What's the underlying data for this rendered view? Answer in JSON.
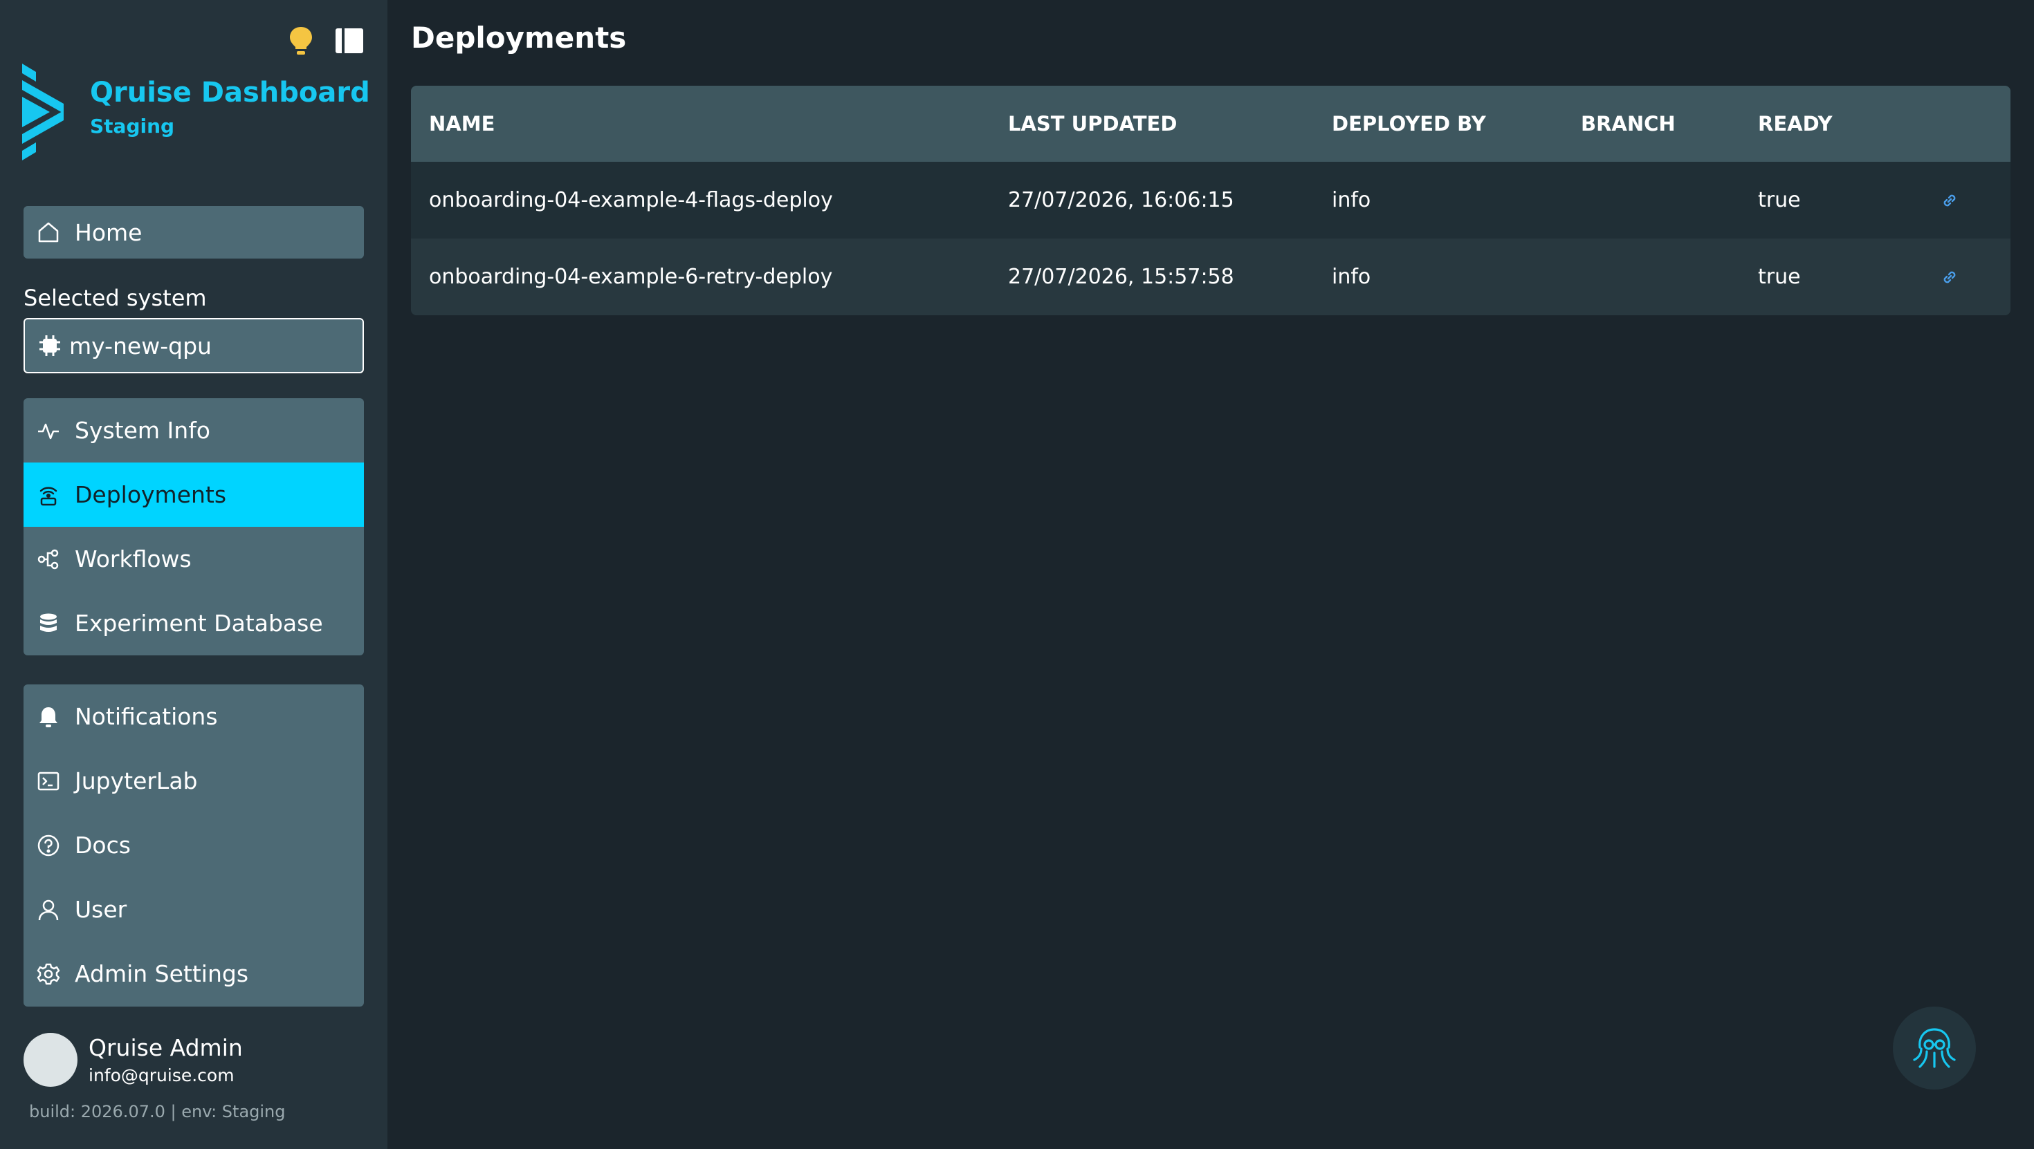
{
  "brand": {
    "title": "Qruise Dashboard",
    "subtitle": "Staging",
    "accent": "#17c7f0"
  },
  "top_icons": [
    "lightbulb-icon",
    "sidebar-toggle-icon"
  ],
  "nav": {
    "home": "Home",
    "selected_system_label": "Selected system",
    "selected_system": "my-new-qpu",
    "group1": [
      {
        "label": "System Info",
        "icon": "pulse-icon"
      },
      {
        "label": "Deployments",
        "icon": "deployments-icon",
        "active": true
      },
      {
        "label": "Workflows",
        "icon": "workflow-icon"
      },
      {
        "label": "Experiment Database",
        "icon": "database-icon"
      }
    ],
    "group2": [
      {
        "label": "Notifications",
        "icon": "bell-icon"
      },
      {
        "label": "JupyterLab",
        "icon": "terminal-icon"
      },
      {
        "label": "Docs",
        "icon": "help-icon"
      },
      {
        "label": "User",
        "icon": "user-icon"
      },
      {
        "label": "Admin Settings",
        "icon": "gear-icon"
      }
    ]
  },
  "user": {
    "name": "Qruise Admin",
    "email": "info@qruise.com"
  },
  "build_info": "build: 2026.07.0 | env: Staging",
  "main": {
    "title": "Deployments",
    "columns": [
      "NAME",
      "LAST UPDATED",
      "DEPLOYED BY",
      "BRANCH",
      "READY"
    ],
    "rows": [
      {
        "name": "onboarding-04-example-4-flags-deploy",
        "updated": "27/07/2026, 16:06:15",
        "by": "info",
        "branch": "",
        "ready": "true"
      },
      {
        "name": "onboarding-04-example-6-retry-deploy",
        "updated": "27/07/2026, 15:57:58",
        "by": "info",
        "branch": "",
        "ready": "true"
      }
    ]
  },
  "colors": {
    "active_nav": "#00d4ff",
    "link": "#4a9eea",
    "lightbulb": "#f5c542"
  }
}
